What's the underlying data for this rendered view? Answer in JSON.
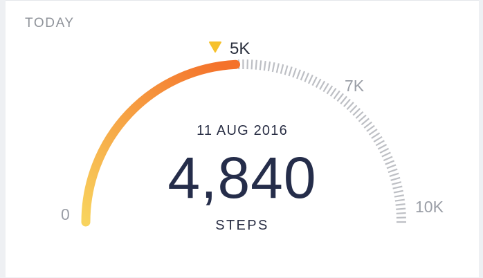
{
  "header": {
    "period": "TODAY"
  },
  "gauge": {
    "min_label": "0",
    "max_label": "10K",
    "mid_label": "7K",
    "goal_label": "5K",
    "min_value": 0,
    "max_value": 10000,
    "goal_value": 5000,
    "current_value": 4840,
    "colors": {
      "progress_start": "#f8d35e",
      "progress_end": "#f4722b",
      "ticks": "#bdbfc4",
      "goal_marker": "#f6c12b"
    }
  },
  "summary": {
    "date": "11 AUG 2016",
    "value": "4,840",
    "unit": "STEPS"
  }
}
